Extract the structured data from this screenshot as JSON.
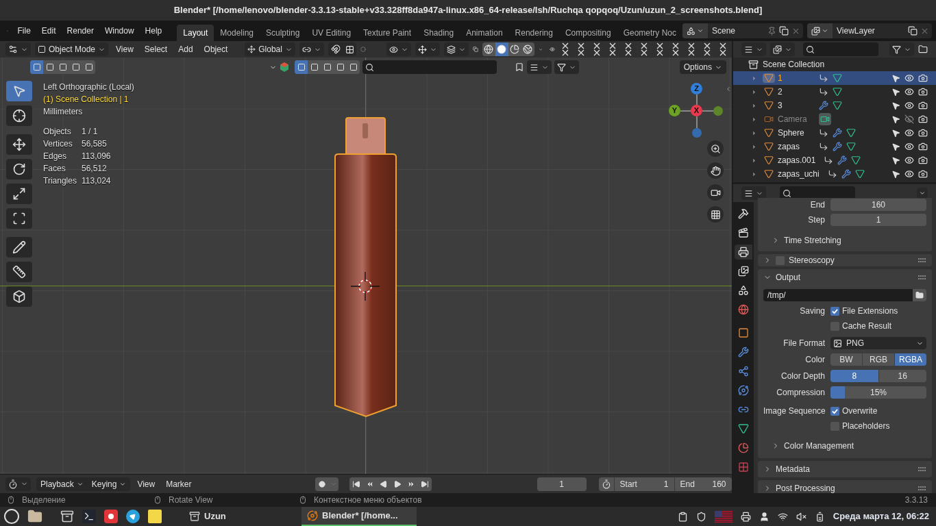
{
  "window": {
    "title": "Blender* [/home/lenovo/blender-3.3.13-stable+v33.328ff8da947a-linux.x86_64-release/Ish/Ruchqa qopqoq/Uzun/uzun_2_screenshots.blend]"
  },
  "menu": [
    "File",
    "Edit",
    "Render",
    "Window",
    "Help"
  ],
  "workspaces": [
    {
      "label": "Layout",
      "selected": true
    },
    {
      "label": "Modeling",
      "selected": false
    },
    {
      "label": "Sculpting",
      "selected": false
    },
    {
      "label": "UV Editing",
      "selected": false
    },
    {
      "label": "Texture Paint",
      "selected": false
    },
    {
      "label": "Shading",
      "selected": false
    },
    {
      "label": "Animation",
      "selected": false
    },
    {
      "label": "Rendering",
      "selected": false
    },
    {
      "label": "Compositing",
      "selected": false
    },
    {
      "label": "Geometry Noc",
      "selected": false
    }
  ],
  "scene": "Scene",
  "view_layer": "ViewLayer",
  "viewport_header": {
    "mode": "Object Mode",
    "menus": [
      "View",
      "Select",
      "Add",
      "Object"
    ],
    "orientation": "Global",
    "options": "Options",
    "shading": [
      {
        "kind": "wireframe",
        "selected": false
      },
      {
        "kind": "solid",
        "selected": true
      },
      {
        "kind": "material",
        "selected": false
      },
      {
        "kind": "rendered",
        "selected": false
      }
    ]
  },
  "tools": [
    {
      "kind": "select",
      "selected": true
    },
    {
      "kind": "cursor",
      "selected": false
    },
    {
      "kind": "move",
      "selected": false
    },
    {
      "kind": "rotate",
      "selected": false
    },
    {
      "kind": "scale",
      "selected": false
    },
    {
      "kind": "transform",
      "selected": false
    },
    {
      "kind": "annotate",
      "selected": false
    },
    {
      "kind": "measure",
      "selected": false
    },
    {
      "kind": "add_cube",
      "selected": false
    }
  ],
  "viewport_info": {
    "view": "Left Orthographic (Local)",
    "collection": "(1) Scene Collection | 1",
    "units": "Millimeters",
    "stats": [
      {
        "label": "Objects",
        "value": "1 / 1"
      },
      {
        "label": "Vertices",
        "value": "56,585"
      },
      {
        "label": "Edges",
        "value": "113,096"
      },
      {
        "label": "Faces",
        "value": "56,512"
      },
      {
        "label": "Triangles",
        "value": "113,024"
      }
    ]
  },
  "gizmo": [
    {
      "label": "Z",
      "color": "#2f7fdb"
    },
    {
      "label": "Y",
      "color": "#6ba422"
    },
    {
      "label": "X",
      "color": "#e8394d"
    }
  ],
  "outliner": {
    "root": "Scene Collection",
    "items": [
      {
        "name": "1",
        "kind": "mesh",
        "selected": true,
        "visible": true,
        "data": [
          {
            "kind": "link"
          },
          {
            "kind": "mesh"
          }
        ]
      },
      {
        "name": "2",
        "kind": "mesh",
        "selected": false,
        "visible": true,
        "data": [
          {
            "kind": "link"
          },
          {
            "kind": "mesh"
          }
        ]
      },
      {
        "name": "3",
        "kind": "mesh",
        "selected": false,
        "visible": true,
        "data": [
          {
            "kind": "wrench"
          },
          {
            "kind": "mesh"
          }
        ]
      },
      {
        "name": "Camera",
        "kind": "camera",
        "selected": false,
        "visible": false,
        "data": [
          {
            "kind": "camera"
          }
        ]
      },
      {
        "name": "Sphere",
        "kind": "mesh",
        "selected": false,
        "visible": true,
        "data": [
          {
            "kind": "link"
          },
          {
            "kind": "wrench"
          },
          {
            "kind": "mesh"
          }
        ]
      },
      {
        "name": "zapas",
        "kind": "mesh",
        "selected": false,
        "visible": true,
        "data": [
          {
            "kind": "link"
          },
          {
            "kind": "wrench"
          },
          {
            "kind": "mesh"
          }
        ]
      },
      {
        "name": "zapas.001",
        "kind": "mesh",
        "selected": false,
        "visible": true,
        "data": [
          {
            "kind": "link"
          },
          {
            "kind": "wrench"
          },
          {
            "kind": "mesh"
          }
        ]
      },
      {
        "name": "zapas_uchi",
        "kind": "mesh",
        "selected": false,
        "visible": true,
        "data": [
          {
            "kind": "link"
          },
          {
            "kind": "wrench"
          },
          {
            "kind": "mesh"
          }
        ]
      }
    ]
  },
  "properties": {
    "tabs": [
      {
        "kind": "tool",
        "selected": false
      },
      {
        "kind": "render",
        "selected": false
      },
      {
        "kind": "output",
        "selected": true
      },
      {
        "kind": "view_layer",
        "selected": false
      },
      {
        "kind": "scene",
        "selected": false
      },
      {
        "kind": "world",
        "selected": false
      },
      {
        "kind": "object",
        "selected": false
      },
      {
        "kind": "modifiers",
        "selected": false
      },
      {
        "kind": "particles",
        "selected": false
      },
      {
        "kind": "physics",
        "selected": false
      },
      {
        "kind": "constraints",
        "selected": false
      },
      {
        "kind": "data",
        "selected": false
      },
      {
        "kind": "material",
        "selected": false
      },
      {
        "kind": "texture",
        "selected": false
      }
    ],
    "frame_rows": [
      {
        "label": "End",
        "value": "160"
      },
      {
        "label": "Step",
        "value": "1"
      }
    ],
    "time_stretching": {
      "label": "Time Stretching",
      "expanded": false
    },
    "stereoscopy": {
      "label": "Stereoscopy",
      "expanded": false,
      "checked": false
    },
    "output": {
      "label": "Output",
      "expanded": true,
      "path": "/tmp/",
      "saving_label": "Saving",
      "saving": [
        {
          "label": "File Extensions",
          "checked": true
        },
        {
          "label": "Cache Result",
          "checked": false
        }
      ],
      "file_format": {
        "label": "File Format",
        "value": "PNG"
      },
      "color": {
        "label": "Color",
        "options": [
          {
            "label": "BW",
            "selected": false
          },
          {
            "label": "RGB",
            "selected": false
          },
          {
            "label": "RGBA",
            "selected": true
          }
        ]
      },
      "color_depth": {
        "label": "Color Depth",
        "options": [
          {
            "label": "8",
            "selected": true
          },
          {
            "label": "16",
            "selected": false
          }
        ]
      },
      "compression": {
        "label": "Compression",
        "value": "15%",
        "level": 0.15
      },
      "image_sequence_label": "Image Sequence",
      "image_sequence": [
        {
          "label": "Overwrite",
          "checked": true
        },
        {
          "label": "Placeholders",
          "checked": false
        }
      ],
      "color_management": {
        "label": "Color Management",
        "expanded": false
      }
    },
    "metadata": {
      "label": "Metadata",
      "expanded": false
    },
    "post_processing": {
      "label": "Post Processing",
      "expanded": false
    }
  },
  "timeline": {
    "menus": [
      "Playback",
      "Keying",
      "View",
      "Marker"
    ],
    "current_frame": "1",
    "start": {
      "label": "Start",
      "value": "1"
    },
    "end": {
      "label": "End",
      "value": "160"
    }
  },
  "status_bar": {
    "hints": [
      "Выделение",
      "Rotate View",
      "Контекстное меню объектов"
    ],
    "version": "3.3.13"
  },
  "taskbar": {
    "windows": [
      {
        "label": "Uzun",
        "selected": false
      },
      {
        "label": "Blender* [/home...",
        "selected": true
      }
    ],
    "clock": "Среда марта 12, 06:22"
  }
}
